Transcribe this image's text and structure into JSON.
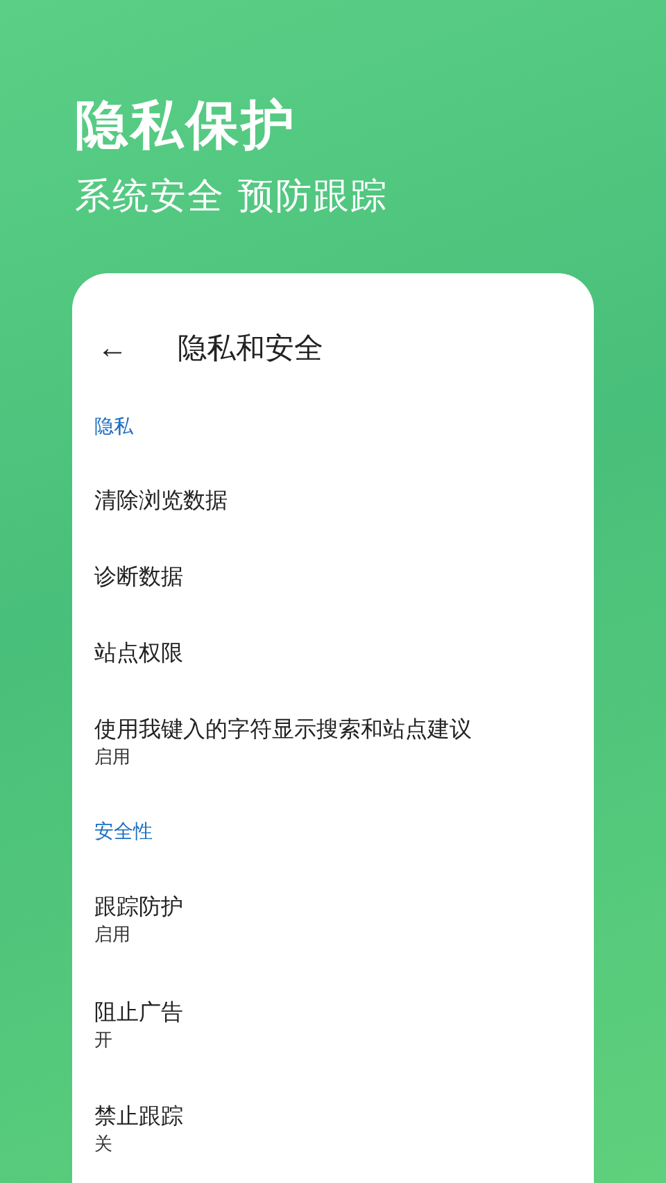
{
  "hero": {
    "title": "隐私保护",
    "subtitle": "系统安全 预防跟踪"
  },
  "screen": {
    "back": "←",
    "title": "隐私和安全",
    "sections": [
      {
        "header": "隐私",
        "items": [
          {
            "label": "清除浏览数据"
          },
          {
            "label": "诊断数据"
          },
          {
            "label": "站点权限"
          },
          {
            "label": "使用我键入的字符显示搜索和站点建议",
            "value": "启用"
          }
        ]
      },
      {
        "header": "安全性",
        "items": [
          {
            "label": "跟踪防护",
            "value": "启用"
          },
          {
            "label": "阻止广告",
            "value": "开"
          },
          {
            "label": "禁止跟踪",
            "value": "关"
          }
        ]
      }
    ]
  }
}
